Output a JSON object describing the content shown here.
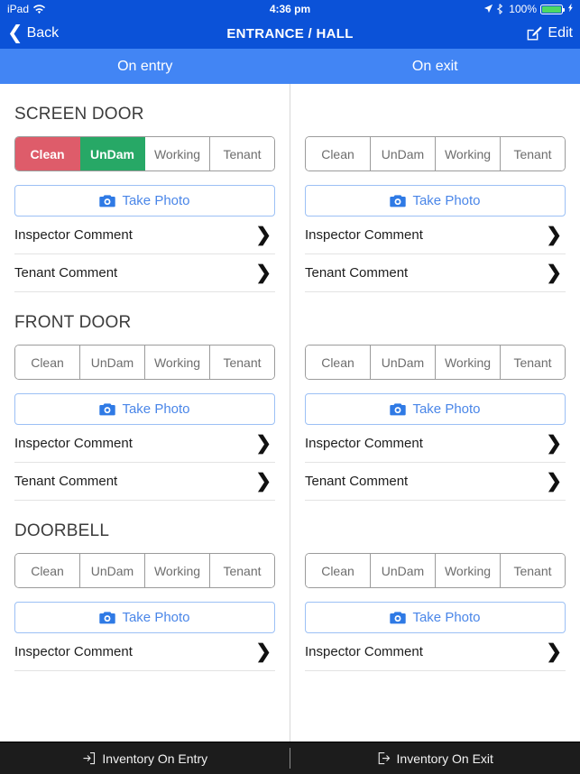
{
  "status_bar": {
    "carrier": "iPad",
    "wifi_icon": "wifi-icon",
    "time": "4:36 pm",
    "location_icon": "location-arrow-icon",
    "bluetooth_icon": "bluetooth-icon",
    "battery_percent": "100%",
    "battery_icon": "battery-full-icon",
    "charging_icon": "lightning-bolt-icon"
  },
  "nav": {
    "back_label": "Back",
    "back_icon": "chevron-left-icon",
    "title": "ENTRANCE / HALL",
    "edit_label": "Edit",
    "edit_icon": "compose-pencil-icon"
  },
  "tabs": [
    {
      "label": "On entry",
      "active": true
    },
    {
      "label": "On exit",
      "active": false
    }
  ],
  "labels": {
    "take_photo": "Take Photo",
    "camera_icon": "camera-icon",
    "inspector_comment": "Inspector Comment",
    "tenant_comment": "Tenant Comment",
    "chevron_right": "chevron-right-icon"
  },
  "segment_options": [
    "Clean",
    "UnDam",
    "Working",
    "Tenant"
  ],
  "colors": {
    "nav_blue": "#0B52D8",
    "tab_blue": "#4285F4",
    "selected_red": "#DE5C6A",
    "selected_green": "#27A866",
    "link_blue": "#4A86E8",
    "toolbar_dark": "#1C1C1C"
  },
  "sections": {
    "entry": [
      {
        "title": "SCREEN DOOR",
        "selected": {
          "Clean": "red",
          "UnDam": "green"
        }
      },
      {
        "title": "FRONT DOOR",
        "selected": {}
      },
      {
        "title": "DOORBELL",
        "selected": {}
      }
    ],
    "exit": [
      {
        "title": "",
        "selected": {}
      },
      {
        "title": "",
        "selected": {}
      },
      {
        "title": "",
        "selected": {}
      }
    ]
  },
  "toolbar": {
    "items": [
      {
        "label": "Inventory On Entry",
        "icon": "arrow-into-box-icon"
      },
      {
        "label": "Inventory On Exit",
        "icon": "arrow-out-of-box-icon"
      }
    ]
  }
}
